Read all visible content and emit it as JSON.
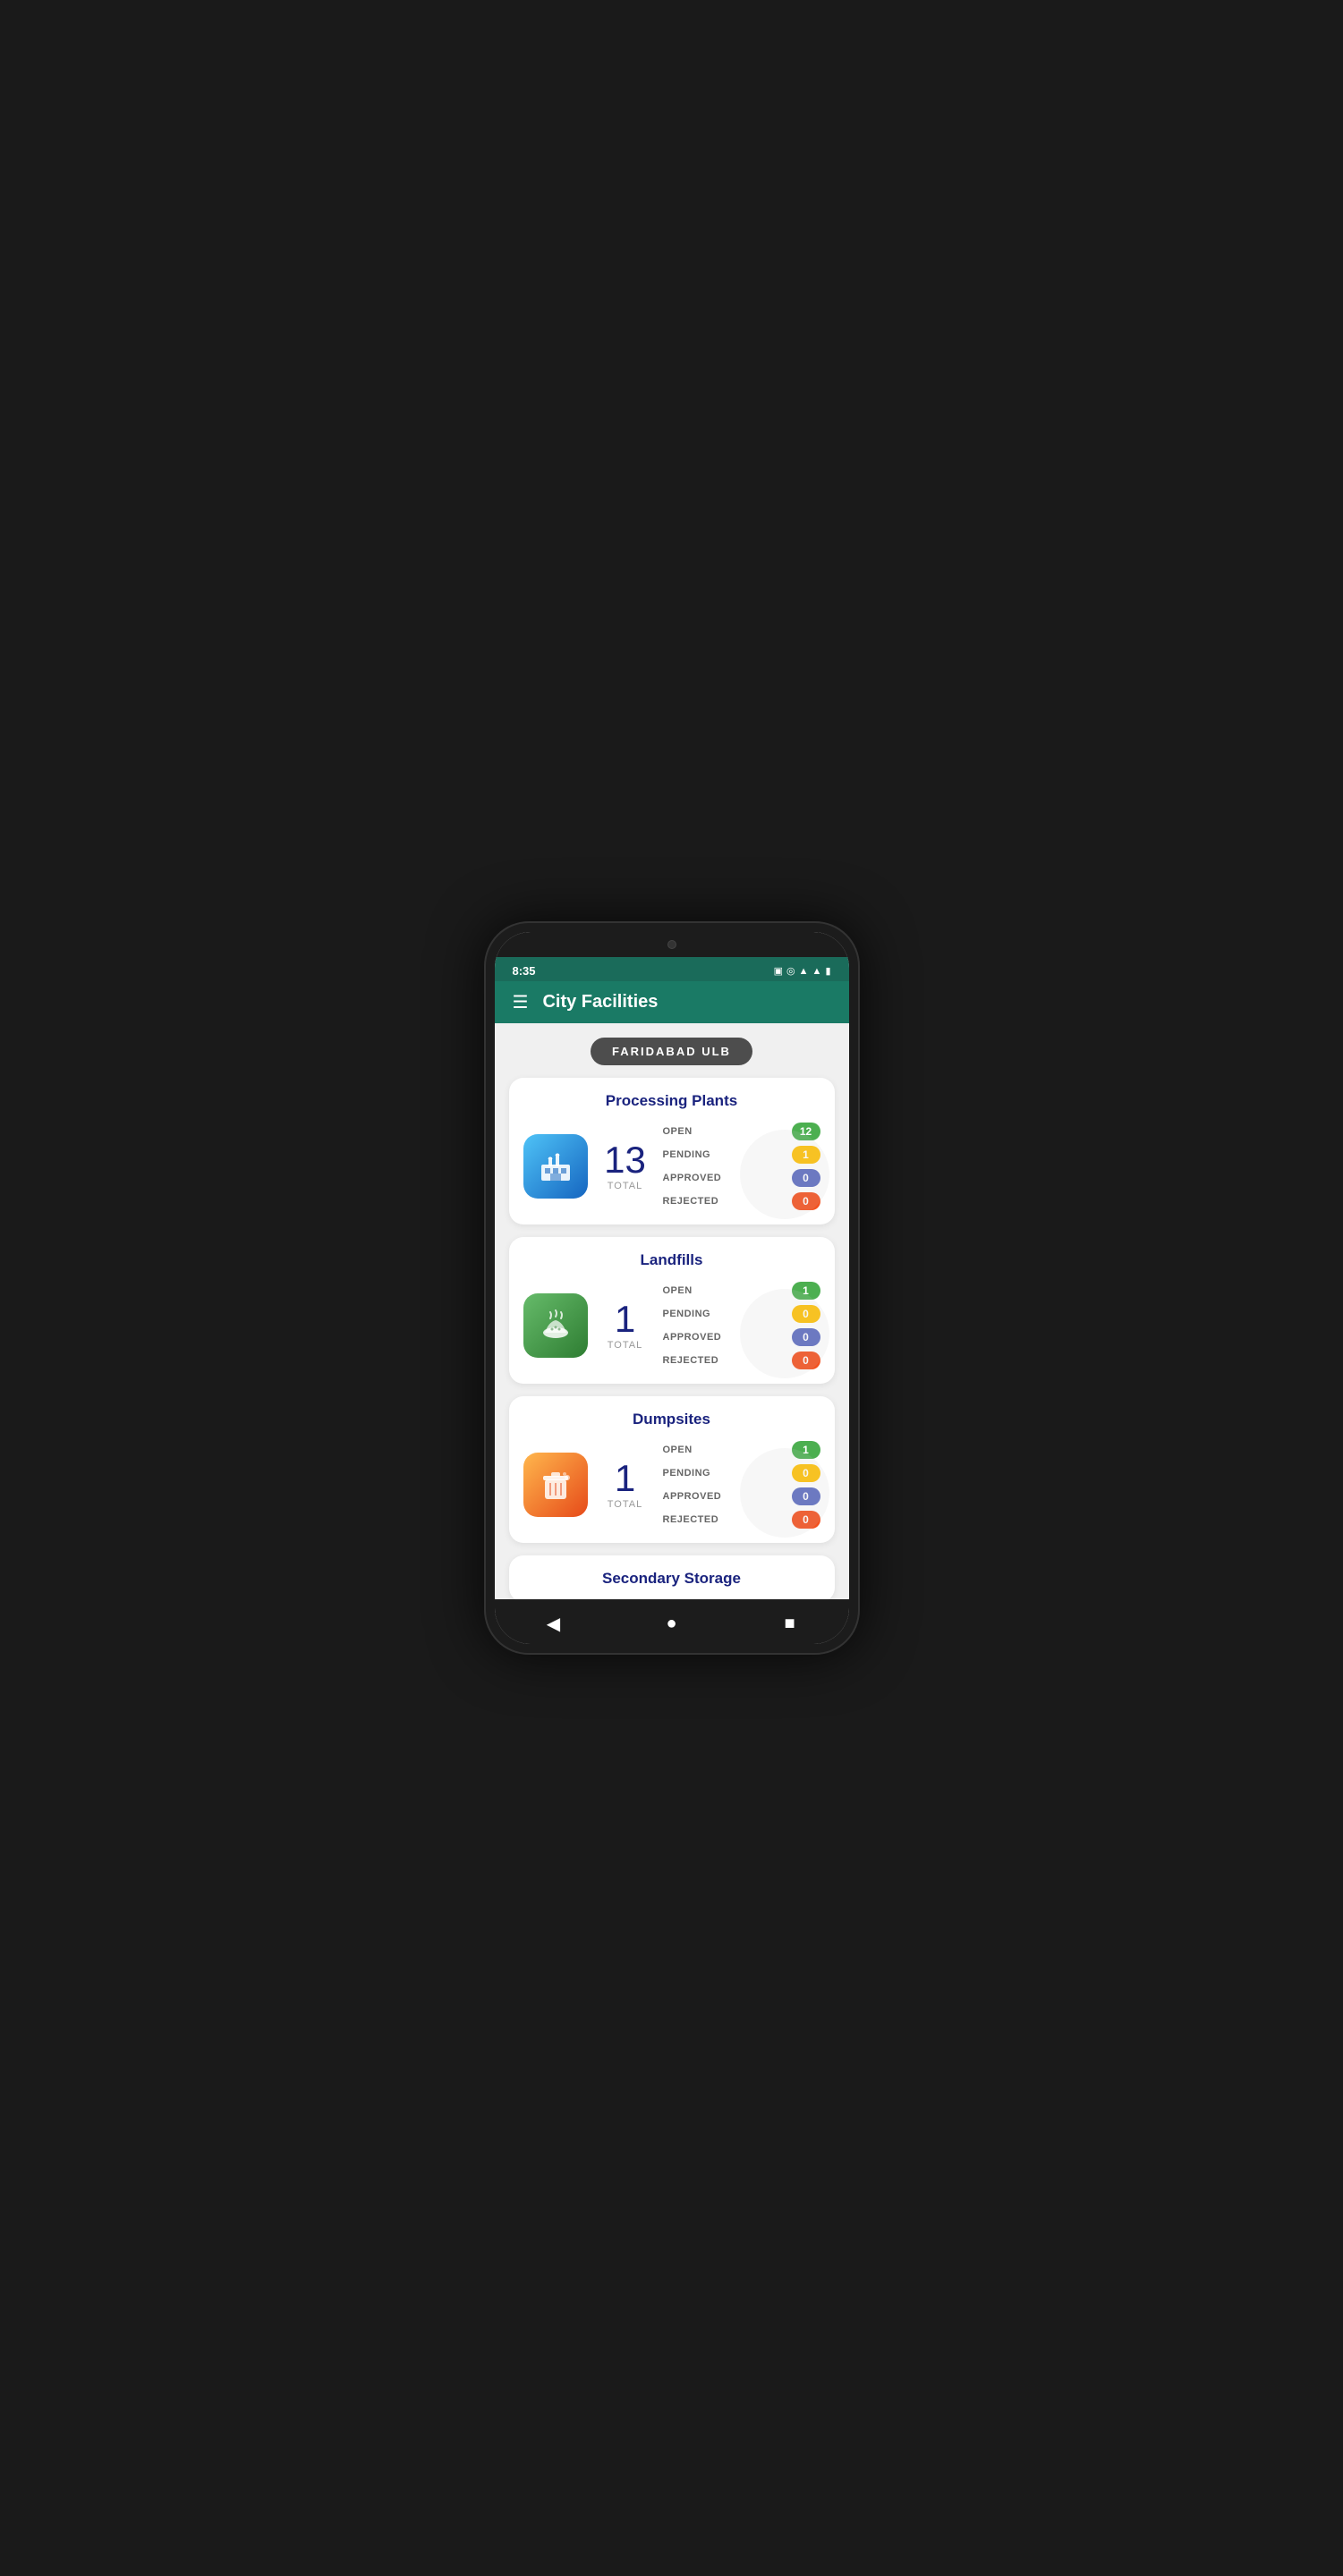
{
  "status_bar": {
    "time": "8:35",
    "icons": [
      "sim",
      "hotspot",
      "wifi",
      "signal",
      "battery"
    ]
  },
  "header": {
    "menu_icon": "☰",
    "title": "City Facilities"
  },
  "ulb": {
    "name": "FARIDABAD ULB"
  },
  "facilities": [
    {
      "id": "processing-plants",
      "title": "Processing Plants",
      "icon_type": "factory",
      "icon_gradient": "blue",
      "total": "13",
      "total_label": "TOTAL",
      "stats": [
        {
          "label": "OPEN",
          "value": "12",
          "color": "green"
        },
        {
          "label": "PENDING",
          "value": "1",
          "color": "yellow"
        },
        {
          "label": "APPROVED",
          "value": "0",
          "color": "blue"
        },
        {
          "label": "REJECTED",
          "value": "0",
          "color": "orange"
        }
      ]
    },
    {
      "id": "landfills",
      "title": "Landfills",
      "icon_type": "landfill",
      "icon_gradient": "green",
      "total": "1",
      "total_label": "TOTAL",
      "stats": [
        {
          "label": "OPEN",
          "value": "1",
          "color": "green"
        },
        {
          "label": "PENDING",
          "value": "0",
          "color": "yellow"
        },
        {
          "label": "APPROVED",
          "value": "0",
          "color": "blue"
        },
        {
          "label": "REJECTED",
          "value": "0",
          "color": "orange"
        }
      ]
    },
    {
      "id": "dumpsites",
      "title": "Dumpsites",
      "icon_type": "dumpsite",
      "icon_gradient": "orange",
      "total": "1",
      "total_label": "TOTAL",
      "stats": [
        {
          "label": "OPEN",
          "value": "1",
          "color": "green"
        },
        {
          "label": "PENDING",
          "value": "0",
          "color": "yellow"
        },
        {
          "label": "APPROVED",
          "value": "0",
          "color": "blue"
        },
        {
          "label": "REJECTED",
          "value": "0",
          "color": "orange"
        }
      ]
    }
  ],
  "partial_section": {
    "title": "Secondary Storage"
  },
  "nav": {
    "back": "◀",
    "home": "●",
    "recent": "■"
  }
}
